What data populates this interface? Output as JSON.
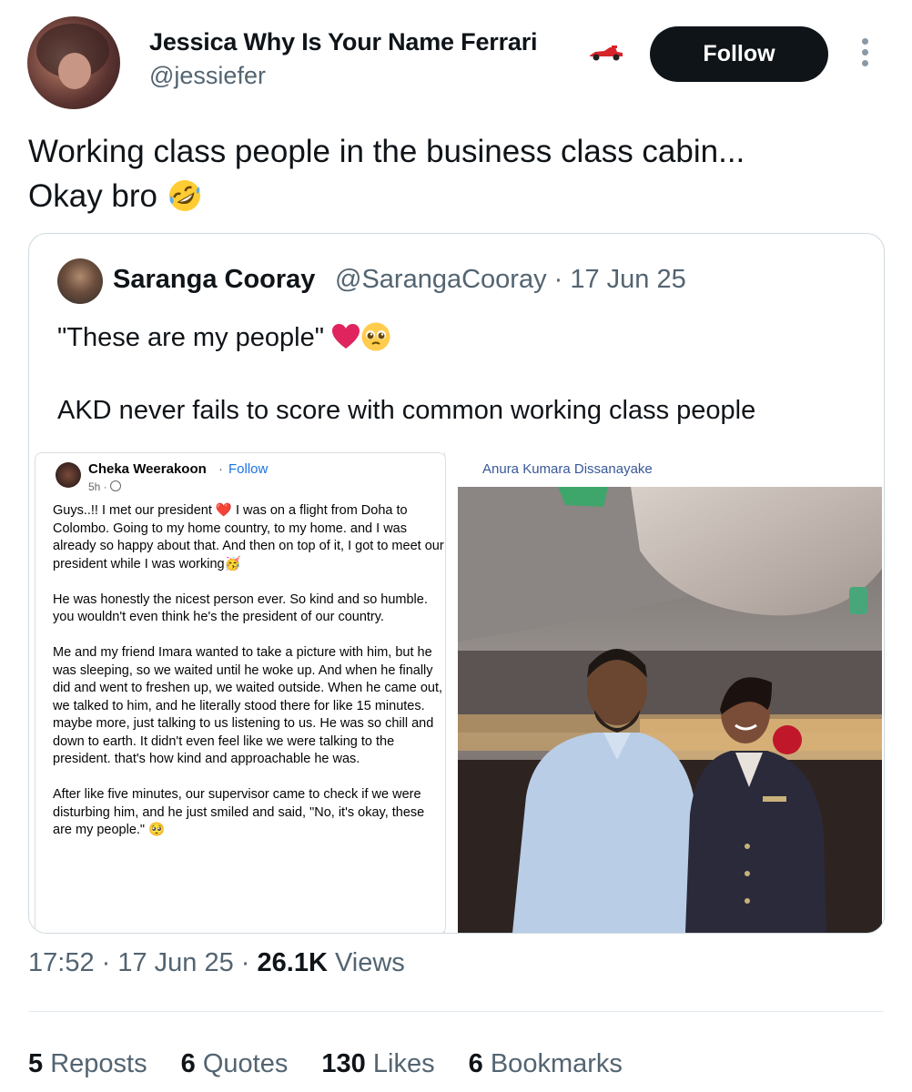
{
  "author": {
    "name": "Jessica Why Is Your Name Ferrari",
    "handle": "@jessiefer",
    "follow_label": "Follow",
    "name_icon": "race-car-icon"
  },
  "tweet": {
    "text_line1": "Working class people in the business class cabin...",
    "text_line2": "Okay bro",
    "emoji": "rolling-on-floor-laughing-icon"
  },
  "quote": {
    "name": "Saranga Cooray",
    "handle_date": "@SarangaCooray · 17 Jun 25",
    "line1": "\"These are my people\"",
    "line2": "AKD never fails to score with common working class people",
    "emojis": [
      "red-heart-icon",
      "pleading-face-icon"
    ]
  },
  "fb_post": {
    "name": "Cheka Weerakoon",
    "dot": "·",
    "follow": "Follow",
    "time": "5h ·",
    "p1": "Guys..!! I met our president ❤️ I was on a flight from Doha to Colombo. Going to my home country, to my home. and I was already so happy about that. And then on top of it, I got to meet our president while I was working🥳",
    "p2": "He was honestly the nicest person ever. So kind and so humble. you wouldn't even think he's the president of our country.",
    "p3": "Me and my friend Imara wanted to take a picture with him, but he was sleeping, so we waited until he woke up. And when he finally did and went to freshen up, we waited outside. When he came out, we talked to him, and he literally stood there for like 15 minutes. maybe more, just talking to us listening to us. He was so chill and down to earth. It didn't even feel like we were talking to the president. that's how kind and approachable he was.",
    "p4": "After like five minutes, our supervisor came to check if we were disturbing him, and he just smiled and said, \"No, it's okay, these are my people.\" 🥺"
  },
  "photo": {
    "caption": "Anura Kumara Dissanayake"
  },
  "meta": {
    "time": "17:52 · 17 Jun 25 ·",
    "views_count": "26.1K",
    "views_label": "Views"
  },
  "stats": [
    {
      "count": "5",
      "label": "Reposts"
    },
    {
      "count": "6",
      "label": "Quotes"
    },
    {
      "count": "130",
      "label": "Likes"
    },
    {
      "count": "6",
      "label": "Bookmarks"
    }
  ],
  "colors": {
    "text": "#0f1419",
    "secondary": "#536471",
    "follow_bg": "#0f1419",
    "fb_link": "#1b74e4",
    "border": "#cfd9de"
  }
}
